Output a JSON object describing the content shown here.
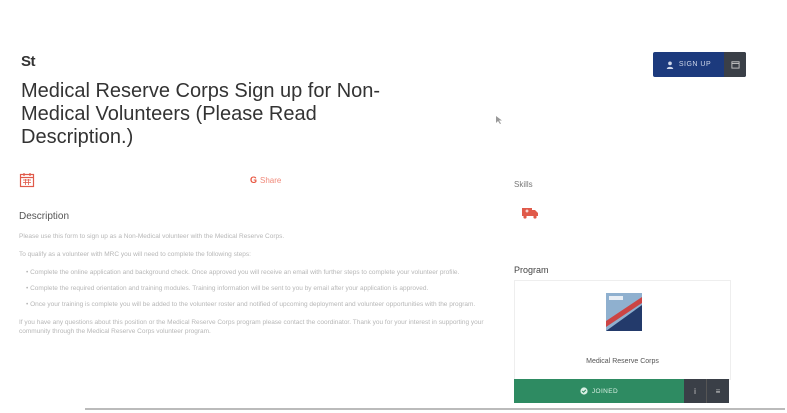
{
  "header": {
    "logo": "St",
    "title": "Medical Reserve Corps Sign up for Non-Medical Volunteers (Please Read Description.)"
  },
  "signup_button": {
    "label": "SIGN UP",
    "icon": "user-icon",
    "side_icon": "calendar-add-icon"
  },
  "share": {
    "icon": "google-icon",
    "glyph": "G",
    "label": "Share"
  },
  "description": {
    "heading": "Description",
    "paragraphs": [
      "Please use this form to sign up as a Non-Medical volunteer with the Medical Reserve Corps.",
      "To qualify as a volunteer with MRC you will need to complete the following steps:"
    ],
    "bullets": [
      "Complete the online application and background check. Once approved you will receive an email with further steps to complete your volunteer profile.",
      "Complete the required orientation and training modules. Training information will be sent to you by email after your application is approved.",
      "Once your training is complete you will be added to the volunteer roster and notified of upcoming deployment and volunteer opportunities with the program."
    ],
    "closing": "If you have any questions about this position or the Medical Reserve Corps program please contact the coordinator. Thank you for your interest in supporting your community through the Medical Reserve Corps volunteer program."
  },
  "skills": {
    "label": "Skills",
    "icon": "ambulance-icon",
    "color": "#e05a4a"
  },
  "program": {
    "label": "Program",
    "name": "Medical Reserve Corps"
  },
  "joined_button": {
    "label": "JOINED",
    "icon": "check-circle-icon",
    "opt1": "i",
    "opt2": "≡"
  },
  "colors": {
    "signup": "#1c3a7d",
    "joined": "#2e8b62",
    "accent": "#e8553f"
  }
}
